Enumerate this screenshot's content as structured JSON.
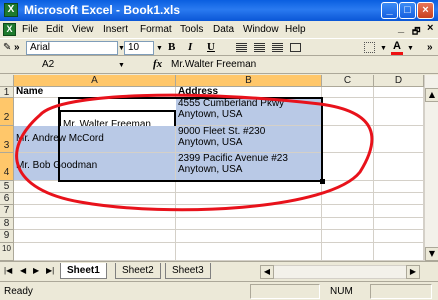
{
  "window": {
    "title": "Microsoft Excel - Book1.xls",
    "min_glyph": "_",
    "max_glyph": "□",
    "close_glyph": "×"
  },
  "menu": {
    "items": [
      "File",
      "Edit",
      "View",
      "Insert",
      "Format",
      "Tools",
      "Data",
      "Window",
      "Help"
    ],
    "help_prompt": "",
    "min_glyph": "_",
    "restore_glyph": "²",
    "close_glyph": "×"
  },
  "toolbar": {
    "font": "Arial",
    "size": "10",
    "bold": "B",
    "italic": "I",
    "underline": "U",
    "chevron": "»",
    "font_color_letter": "A"
  },
  "formula_bar": {
    "cell_ref": "A2",
    "fx": "fx",
    "value": "Mr.Walter Freeman"
  },
  "grid": {
    "columns": [
      "A",
      "B",
      "C",
      "D"
    ],
    "rows": [
      "1",
      "2",
      "3",
      "4",
      "5",
      "6",
      "7",
      "8",
      "9",
      "10"
    ],
    "header_name": "Name",
    "header_address": "Address",
    "records": [
      {
        "name": "Mr. Walter Freeman",
        "address1": "4555 Cumberland Pkwy",
        "address2": "Anytown, USA"
      },
      {
        "name": "Mr. Andrew McCord",
        "address1": "9000 Fleet St. #230",
        "address2": "Anytown, USA"
      },
      {
        "name": "Mr. Bob Goodman",
        "address1": "2399 Pacific Avenue #23",
        "address2": "Anytown, USA"
      }
    ]
  },
  "sheet_tabs": [
    "Sheet1",
    "Sheet2",
    "Sheet3"
  ],
  "status": {
    "left": "Ready",
    "num": "NUM"
  },
  "colors": {
    "selection": "#b9c9e6",
    "highlight_header": "#ffc76a",
    "annotation_ellipse": "#e8121b"
  }
}
